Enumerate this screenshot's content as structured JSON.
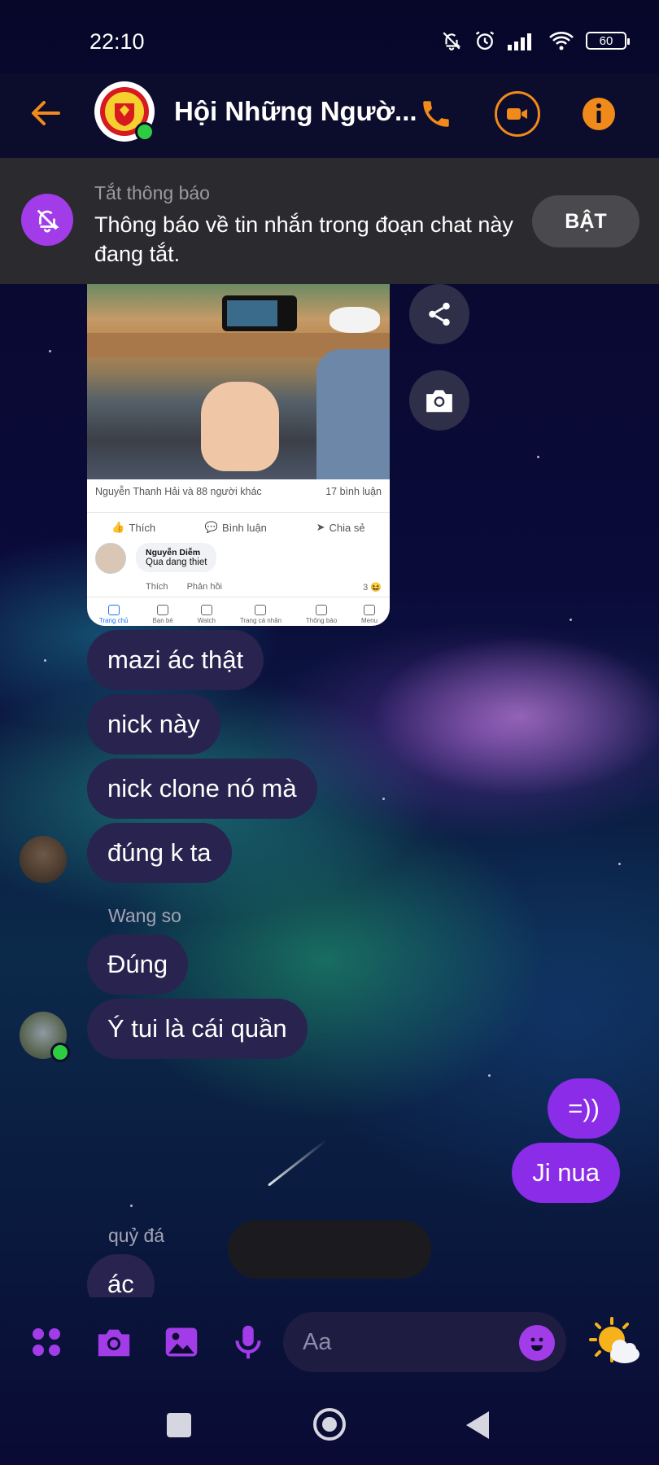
{
  "status_bar": {
    "time": "22:10",
    "battery": "60"
  },
  "header": {
    "group_name": "Hội Những Ngườ...",
    "icons": [
      "back-arrow-icon",
      "phone-icon",
      "video-icon",
      "info-icon"
    ]
  },
  "mute_banner": {
    "title": "Tắt thông báo",
    "text": "Thông báo về tin nhắn trong đoạn chat này đang tắt.",
    "button": "BẬT"
  },
  "shared_post": {
    "reactions_text": "Nguyễn Thanh Hải và 88 người khác",
    "comments_text": "17 bình luận",
    "actions": [
      "Thích",
      "Bình luận",
      "Chia sẻ"
    ],
    "comment": {
      "author": "Nguyễn Diễm",
      "text": "Qua dang thiet",
      "like": "Thích",
      "reply": "Phản hồi",
      "count": "3"
    },
    "nav": [
      "Trang chủ",
      "Bạn bè",
      "Watch",
      "Trang cá nhân",
      "Thông báo",
      "Menu"
    ]
  },
  "messages": [
    {
      "text": "mazi ác thật"
    },
    {
      "text": "nick này"
    },
    {
      "text": "nick clone nó mà"
    },
    {
      "text": "đúng k ta"
    },
    {
      "sender": "Wang so",
      "text": "Đúng"
    },
    {
      "text": "Ý tui là cái quần"
    },
    {
      "text": "=))"
    },
    {
      "text": "Ji nua"
    },
    {
      "sender": "quỷ đá",
      "text": "ác"
    }
  ],
  "composer": {
    "placeholder": "Aa"
  },
  "colors": {
    "accent": "#f08a1a",
    "purple": "#a23be8",
    "bubble_other": "#28234f",
    "bubble_mine": "#8b2ce8"
  }
}
